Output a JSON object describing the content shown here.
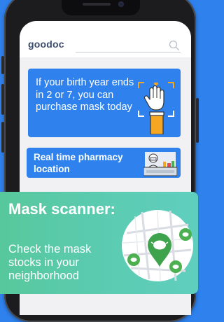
{
  "app": {
    "logo_text": "goodoc",
    "search_icon": "search-icon"
  },
  "cards": {
    "birth_year": {
      "text": "If your birth year ends in 2 or 7, you can purchase mask today",
      "icon": "raised-hand-icon"
    },
    "pharmacy": {
      "text": "Real time pharmacy location",
      "icon": "pharmacist-counter-icon"
    }
  },
  "banner": {
    "title": "Mask scanner:",
    "subtitle": "Check the mask stocks in your neighborhood",
    "icon": "map-mask-pins-icon"
  },
  "colors": {
    "background": "#2f82ee",
    "card_blue": "#2f82ee",
    "banner_green": "#57c89c",
    "pin_green": "#4caf50",
    "hand_orange": "#f5a623"
  }
}
